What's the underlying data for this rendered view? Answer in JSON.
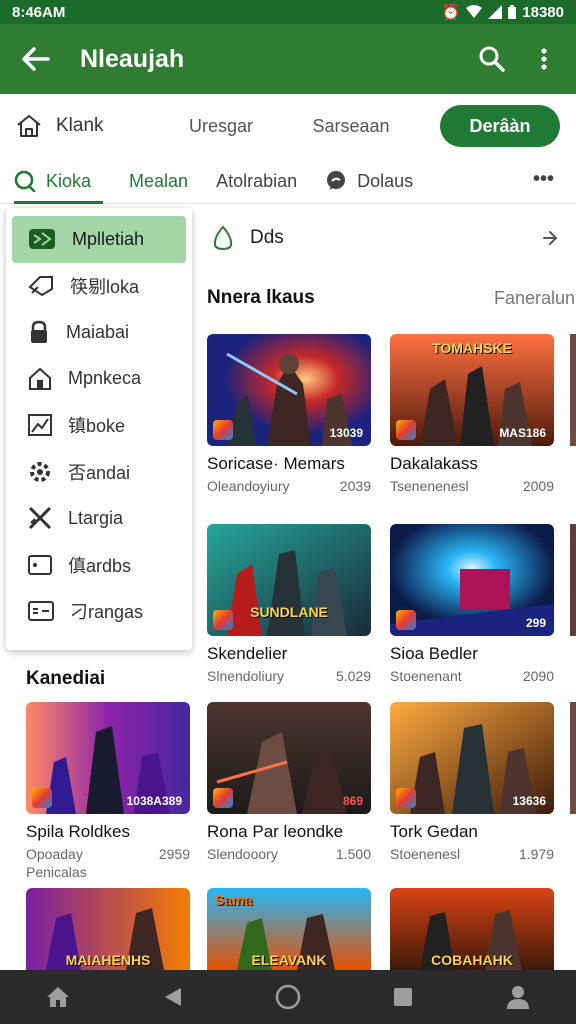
{
  "status_bar": {
    "time": "8:46AM",
    "battery": "18380"
  },
  "app_bar": {
    "title": "Nleaujah",
    "icons": [
      "arrow-left-icon",
      "search-icon",
      "more-vert-icon"
    ]
  },
  "chips": {
    "home_label": "Klank",
    "chip2": "Uresgar",
    "chip3": "Sarseaan",
    "primary": "Derâàn"
  },
  "tabs": [
    {
      "label": "Kioka",
      "active": true
    },
    {
      "label": "Mealan"
    },
    {
      "label": "Atolrabian"
    },
    {
      "label": "Dolaus"
    }
  ],
  "drawer": {
    "items": [
      {
        "label": "Mplletiah",
        "icon": "games-icon",
        "selected": true
      },
      {
        "label": "筷剔loka",
        "icon": "tag-icon"
      },
      {
        "label": "Maiabai",
        "icon": "lock-icon"
      },
      {
        "label": "Mpnkeca",
        "icon": "house-icon"
      },
      {
        "label": "镇boke",
        "icon": "image-icon"
      },
      {
        "label": "否andai",
        "icon": "gear-icon"
      },
      {
        "label": "Ltargia",
        "icon": "swords-icon"
      },
      {
        "label": "傎ardbs",
        "icon": "tablet-icon"
      },
      {
        "label": "刁rangas",
        "icon": "card-icon"
      }
    ]
  },
  "featured": {
    "label": "Dds"
  },
  "sections": {
    "first_title": "Nnera lkaus",
    "first_more": "Faneralun",
    "second_title": "Kanediai"
  },
  "cards": [
    {
      "name": "Soricase· Memars",
      "sub": "Oleandoyiury",
      "value": "2039",
      "thumb_label": "13039"
    },
    {
      "name": "Dakalakass",
      "sub": "Tsenenenesl",
      "value": "2009",
      "thumb_label": "MAS186",
      "banner": "TOMAHSKE"
    },
    {
      "name": "Skendelier",
      "sub": "Slnendoliury",
      "value": "5.029",
      "banner": "SUNDLANE"
    },
    {
      "name": "Sioa Bedler",
      "sub": "Stoenenant",
      "value": "2090",
      "thumb_label": "299"
    },
    {
      "name": "Spila Roldkes",
      "sub": "Opoaday",
      "sub2": "Penicalas",
      "value": "2959",
      "thumb_label": "1038A389"
    },
    {
      "name": "Rona Par leondke",
      "sub": "Slendooory",
      "value": "1.500",
      "thumb_label": "869"
    },
    {
      "name": "Tork Gedan",
      "sub": "Stoenenesl",
      "value": "1.979",
      "thumb_label": "13636"
    },
    {
      "banner": "MAIAHENHS"
    },
    {
      "banner": "ELEAVANK",
      "top": "Sama"
    },
    {
      "banner": "COBAHAHK"
    }
  ]
}
